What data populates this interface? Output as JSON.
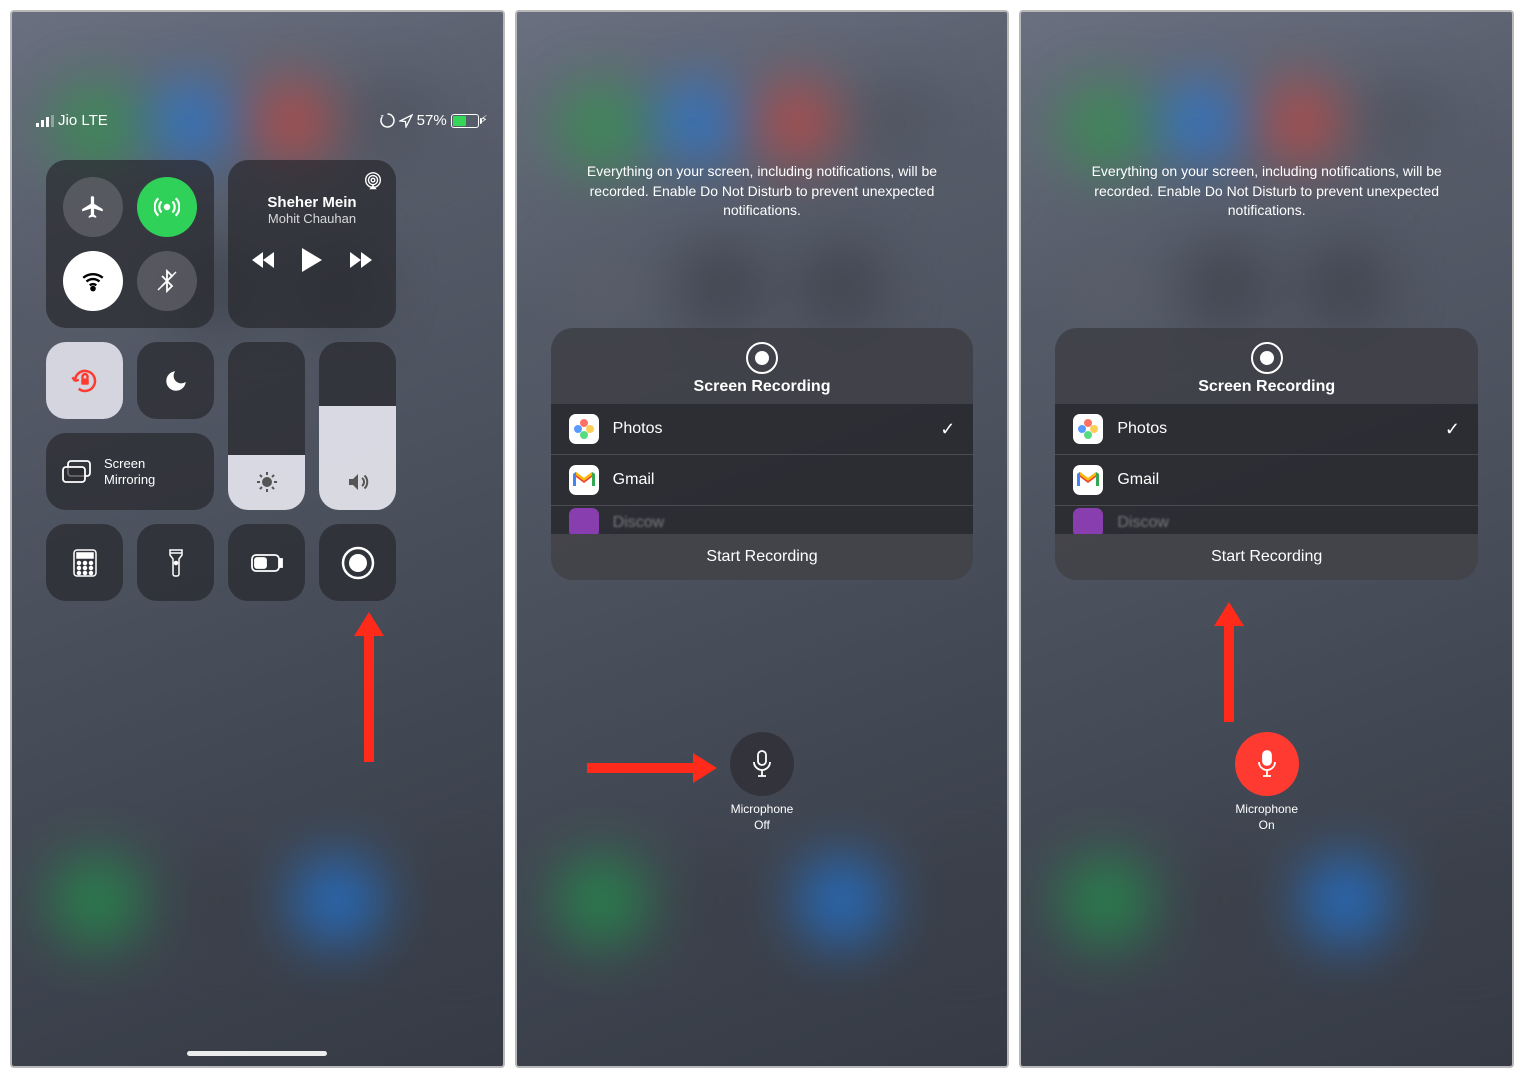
{
  "statusBar": {
    "carrier": "Jio LTE",
    "battery": "57%"
  },
  "connectivity": {
    "airplane": "airplane",
    "cellular": "cellular",
    "wifi": "wifi",
    "bluetooth": "bluetooth"
  },
  "media": {
    "title": "Sheher Mein",
    "artist": "Mohit Chauhan"
  },
  "screenMirroring": "Screen Mirroring",
  "recHint": "Everything on your screen, including notifications, will be recorded. Enable Do Not Disturb to prevent unexpected notifications.",
  "recCard": {
    "title": "Screen Recording",
    "apps": [
      {
        "name": "Photos",
        "selected": true
      },
      {
        "name": "Gmail",
        "selected": false
      },
      {
        "name": "Discow",
        "selected": false
      }
    ],
    "start": "Start Recording"
  },
  "mic": {
    "label": "Microphone",
    "off": "Off",
    "on": "On"
  }
}
